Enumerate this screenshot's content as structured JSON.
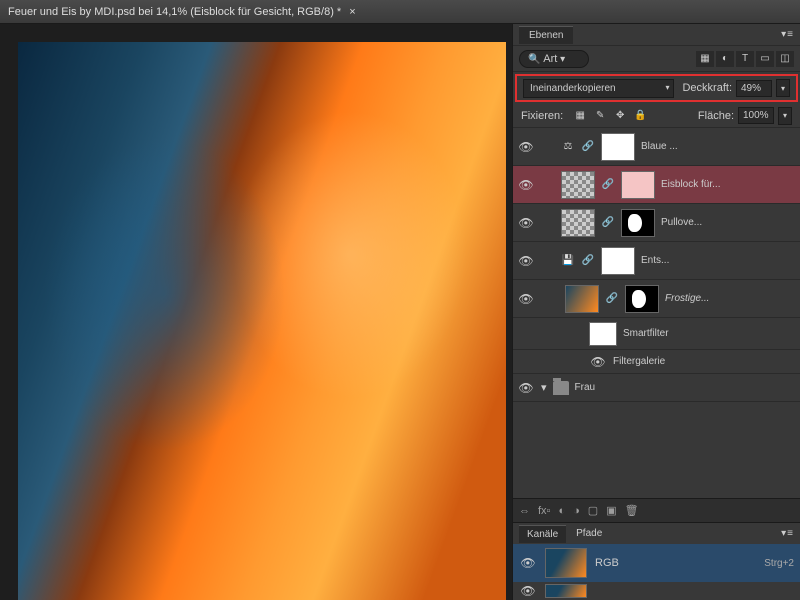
{
  "title": "Feuer und Eis by MDI.psd bei 14,1% (Eisblock für Gesicht, RGB/8) *",
  "panel": {
    "tab": "Ebenen",
    "search_label": "Art"
  },
  "blend": {
    "mode": "Ineinanderkopieren",
    "opacity_label": "Deckkraft:",
    "opacity": "49%"
  },
  "lock": {
    "label": "Fixieren:",
    "fill_label": "Fläche:",
    "fill": "100%"
  },
  "layers": [
    {
      "name": "Blaue ...",
      "mask": "white",
      "extra": "scale"
    },
    {
      "name": "Eisblock für...",
      "selected": true,
      "thumb": "checker"
    },
    {
      "name": "Pullove...",
      "thumb": "checker",
      "mask": "shape"
    },
    {
      "name": "Ents...",
      "mask": "white",
      "extra": "save"
    },
    {
      "name": "Frostige...",
      "thumb": "mini",
      "mask": "shape",
      "italic": true
    },
    {
      "name": "Smartfilter",
      "indent": true,
      "nomask": true
    },
    {
      "name": "Filtergalerie",
      "indent": true,
      "sub": true
    }
  ],
  "group": {
    "name": "Frau"
  },
  "channels": {
    "tab1": "Kanäle",
    "tab2": "Pfade",
    "rgb": "RGB",
    "shortcut": "Strg+2"
  }
}
